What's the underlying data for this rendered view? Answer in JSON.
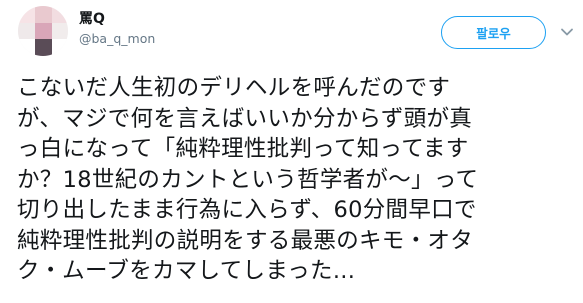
{
  "user": {
    "display_name": "罵Q",
    "handle": "@ba_q_mon"
  },
  "follow_button": {
    "label": "팔로우"
  },
  "menu": {
    "icon": "chevron-down-icon"
  },
  "tweet": {
    "text": "こないだ人生初のデリヘルを呼んだのです\nが、マジで何を言えばいいか分からず頭が真\nっ白になって「純粋理性批判って知ってます\nか？18世紀のカントという哲学者が〜」って\n切り出したまま行為に入らず、60分間早口で\n純粋理性批判の説明をする最悪のキモ・オタ\nク・ムーブをカマしてしまった..."
  },
  "colors": {
    "accent": "#1da1f2",
    "text": "#14171a",
    "secondary": "#657786"
  }
}
